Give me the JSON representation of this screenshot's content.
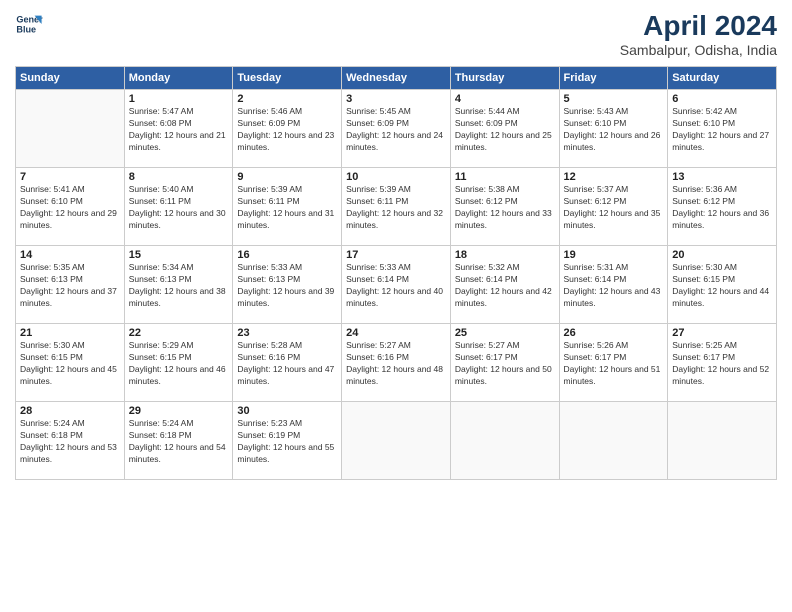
{
  "header": {
    "logo_line1": "General",
    "logo_line2": "Blue",
    "month": "April 2024",
    "location": "Sambalpur, Odisha, India"
  },
  "days_of_week": [
    "Sunday",
    "Monday",
    "Tuesday",
    "Wednesday",
    "Thursday",
    "Friday",
    "Saturday"
  ],
  "weeks": [
    [
      {
        "day": null
      },
      {
        "day": 1,
        "sunrise": "5:47 AM",
        "sunset": "6:08 PM",
        "daylight": "12 hours and 21 minutes."
      },
      {
        "day": 2,
        "sunrise": "5:46 AM",
        "sunset": "6:09 PM",
        "daylight": "12 hours and 23 minutes."
      },
      {
        "day": 3,
        "sunrise": "5:45 AM",
        "sunset": "6:09 PM",
        "daylight": "12 hours and 24 minutes."
      },
      {
        "day": 4,
        "sunrise": "5:44 AM",
        "sunset": "6:09 PM",
        "daylight": "12 hours and 25 minutes."
      },
      {
        "day": 5,
        "sunrise": "5:43 AM",
        "sunset": "6:10 PM",
        "daylight": "12 hours and 26 minutes."
      },
      {
        "day": 6,
        "sunrise": "5:42 AM",
        "sunset": "6:10 PM",
        "daylight": "12 hours and 27 minutes."
      }
    ],
    [
      {
        "day": 7,
        "sunrise": "5:41 AM",
        "sunset": "6:10 PM",
        "daylight": "12 hours and 29 minutes."
      },
      {
        "day": 8,
        "sunrise": "5:40 AM",
        "sunset": "6:11 PM",
        "daylight": "12 hours and 30 minutes."
      },
      {
        "day": 9,
        "sunrise": "5:39 AM",
        "sunset": "6:11 PM",
        "daylight": "12 hours and 31 minutes."
      },
      {
        "day": 10,
        "sunrise": "5:39 AM",
        "sunset": "6:11 PM",
        "daylight": "12 hours and 32 minutes."
      },
      {
        "day": 11,
        "sunrise": "5:38 AM",
        "sunset": "6:12 PM",
        "daylight": "12 hours and 33 minutes."
      },
      {
        "day": 12,
        "sunrise": "5:37 AM",
        "sunset": "6:12 PM",
        "daylight": "12 hours and 35 minutes."
      },
      {
        "day": 13,
        "sunrise": "5:36 AM",
        "sunset": "6:12 PM",
        "daylight": "12 hours and 36 minutes."
      }
    ],
    [
      {
        "day": 14,
        "sunrise": "5:35 AM",
        "sunset": "6:13 PM",
        "daylight": "12 hours and 37 minutes."
      },
      {
        "day": 15,
        "sunrise": "5:34 AM",
        "sunset": "6:13 PM",
        "daylight": "12 hours and 38 minutes."
      },
      {
        "day": 16,
        "sunrise": "5:33 AM",
        "sunset": "6:13 PM",
        "daylight": "12 hours and 39 minutes."
      },
      {
        "day": 17,
        "sunrise": "5:33 AM",
        "sunset": "6:14 PM",
        "daylight": "12 hours and 40 minutes."
      },
      {
        "day": 18,
        "sunrise": "5:32 AM",
        "sunset": "6:14 PM",
        "daylight": "12 hours and 42 minutes."
      },
      {
        "day": 19,
        "sunrise": "5:31 AM",
        "sunset": "6:14 PM",
        "daylight": "12 hours and 43 minutes."
      },
      {
        "day": 20,
        "sunrise": "5:30 AM",
        "sunset": "6:15 PM",
        "daylight": "12 hours and 44 minutes."
      }
    ],
    [
      {
        "day": 21,
        "sunrise": "5:30 AM",
        "sunset": "6:15 PM",
        "daylight": "12 hours and 45 minutes."
      },
      {
        "day": 22,
        "sunrise": "5:29 AM",
        "sunset": "6:15 PM",
        "daylight": "12 hours and 46 minutes."
      },
      {
        "day": 23,
        "sunrise": "5:28 AM",
        "sunset": "6:16 PM",
        "daylight": "12 hours and 47 minutes."
      },
      {
        "day": 24,
        "sunrise": "5:27 AM",
        "sunset": "6:16 PM",
        "daylight": "12 hours and 48 minutes."
      },
      {
        "day": 25,
        "sunrise": "5:27 AM",
        "sunset": "6:17 PM",
        "daylight": "12 hours and 50 minutes."
      },
      {
        "day": 26,
        "sunrise": "5:26 AM",
        "sunset": "6:17 PM",
        "daylight": "12 hours and 51 minutes."
      },
      {
        "day": 27,
        "sunrise": "5:25 AM",
        "sunset": "6:17 PM",
        "daylight": "12 hours and 52 minutes."
      }
    ],
    [
      {
        "day": 28,
        "sunrise": "5:24 AM",
        "sunset": "6:18 PM",
        "daylight": "12 hours and 53 minutes."
      },
      {
        "day": 29,
        "sunrise": "5:24 AM",
        "sunset": "6:18 PM",
        "daylight": "12 hours and 54 minutes."
      },
      {
        "day": 30,
        "sunrise": "5:23 AM",
        "sunset": "6:19 PM",
        "daylight": "12 hours and 55 minutes."
      },
      {
        "day": null
      },
      {
        "day": null
      },
      {
        "day": null
      },
      {
        "day": null
      }
    ]
  ]
}
